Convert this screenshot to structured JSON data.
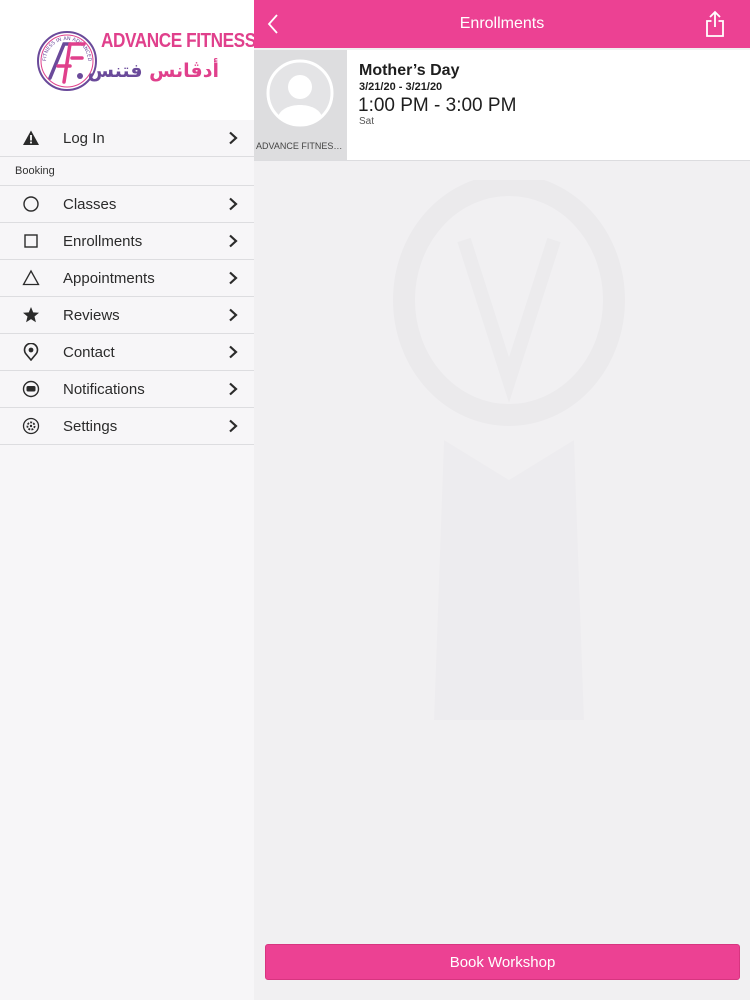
{
  "brand": {
    "name_en": "ADVANCE FITNESS",
    "name_ar_part1": "أدڤانس",
    "name_ar_part2": "فتنس",
    "tagline": "FITNESS IN AN ADVANCED WAY",
    "colors": {
      "pink": "#ec4193",
      "purple": "#6a4a9a"
    }
  },
  "sidebar": {
    "login": {
      "label": "Log In",
      "icon": "warning-icon"
    },
    "section_label": "Booking",
    "items": [
      {
        "label": "Classes",
        "icon": "circle-icon"
      },
      {
        "label": "Enrollments",
        "icon": "square-icon"
      },
      {
        "label": "Appointments",
        "icon": "triangle-icon"
      },
      {
        "label": "Reviews",
        "icon": "star-icon"
      },
      {
        "label": "Contact",
        "icon": "location-pin-icon"
      },
      {
        "label": "Notifications",
        "icon": "chat-bubble-icon"
      },
      {
        "label": "Settings",
        "icon": "gear-icon"
      }
    ]
  },
  "header": {
    "title": "Enrollments",
    "back_icon": "back-chevron-icon",
    "share_icon": "share-icon"
  },
  "enrollment": {
    "title": "Mother’s Day",
    "dates": "3/21/20 - 3/21/20",
    "time": "1:00 PM - 3:00 PM",
    "day": "Sat",
    "studio": "ADVANCE FITNESS..."
  },
  "footer": {
    "book_label": "Book Workshop"
  }
}
